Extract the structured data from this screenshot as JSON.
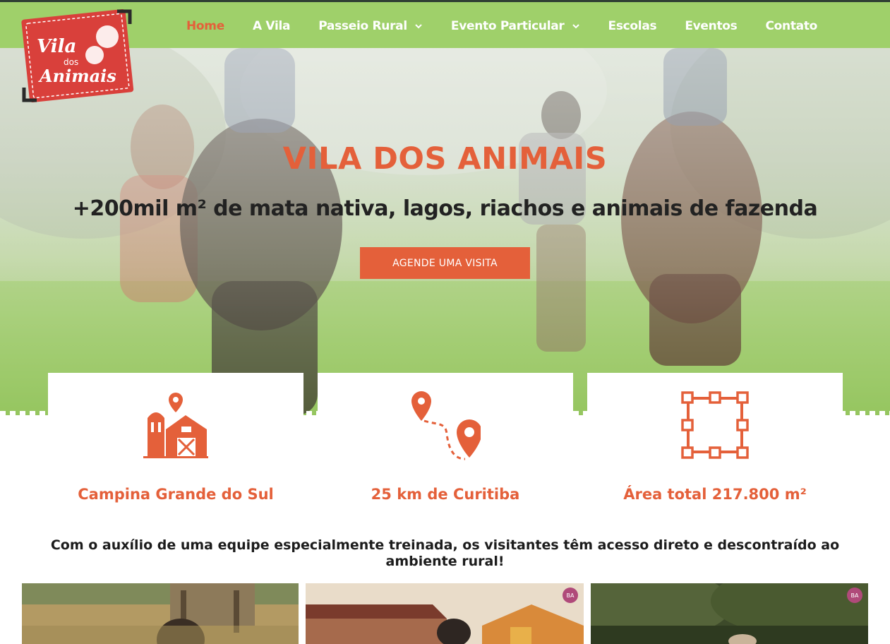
{
  "brand": {
    "logo_line1": "Vila",
    "logo_line2": "dos",
    "logo_line3": "Animais",
    "colors": {
      "accent": "#e4603a",
      "nav_bg": "#9fd06a",
      "dark": "#222222"
    }
  },
  "nav": {
    "items": [
      {
        "label": "Home",
        "active": true,
        "has_dropdown": false
      },
      {
        "label": "A Vila",
        "active": false,
        "has_dropdown": false
      },
      {
        "label": "Passeio Rural",
        "active": false,
        "has_dropdown": true
      },
      {
        "label": "Evento Particular",
        "active": false,
        "has_dropdown": true
      },
      {
        "label": "Escolas",
        "active": false,
        "has_dropdown": false
      },
      {
        "label": "Eventos",
        "active": false,
        "has_dropdown": false
      },
      {
        "label": "Contato",
        "active": false,
        "has_dropdown": false
      }
    ]
  },
  "hero": {
    "title": "VILA DOS ANIMAIS",
    "subtitle": "+200mil m² de mata nativa, lagos, riachos e animais de fazenda",
    "cta_label": "AGENDE UMA VISITA"
  },
  "features": [
    {
      "icon": "barn-location-icon",
      "label": "Campina Grande do Sul"
    },
    {
      "icon": "route-pins-icon",
      "label": "25 km de Curitiba"
    },
    {
      "icon": "area-selection-icon",
      "label": "Área total 217.800 m²"
    }
  ],
  "tagline": "Com o auxílio de uma equipe especialmente treinada, os visitantes têm acesso direto e descontraído ao ambiente rural!",
  "gallery": {
    "photos": [
      {
        "icon": "photo-child-farm",
        "badge": ""
      },
      {
        "icon": "photo-barn-sunset",
        "badge": "BA"
      },
      {
        "icon": "photo-forest-people",
        "badge": "BA"
      }
    ]
  }
}
